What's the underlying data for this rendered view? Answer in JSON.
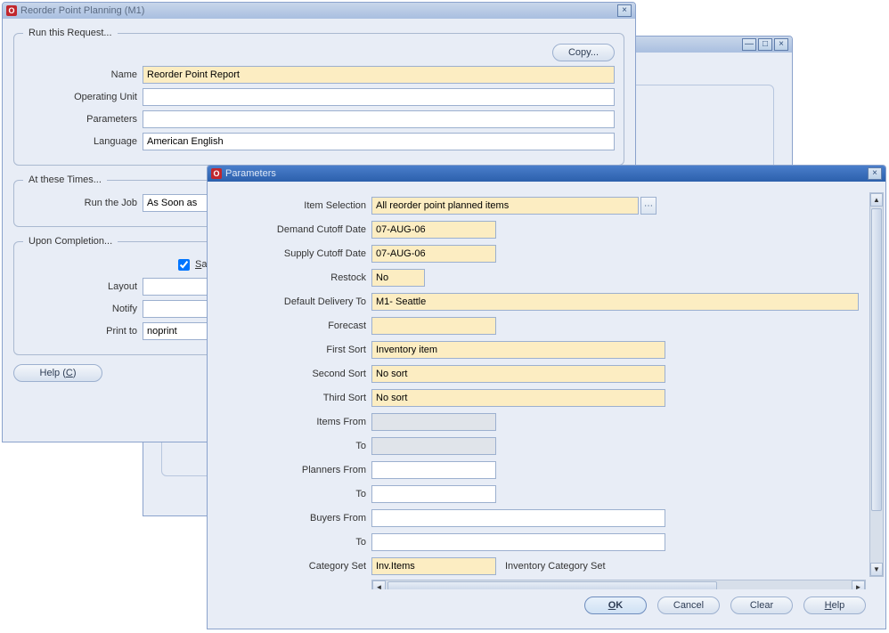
{
  "back_window": {
    "minimize_title": "Minimize",
    "maximize_title": "Maximize",
    "close_title": "Close"
  },
  "rpp": {
    "title": "Reorder Point Planning (M1)",
    "run_legend": "Run this Request...",
    "copy_label": "Copy...",
    "name_label": "Name",
    "name_value": "Reorder Point Report",
    "op_unit_label": "Operating Unit",
    "op_unit_value": "",
    "parameters_label": "Parameters",
    "parameters_value": "",
    "language_label": "Language",
    "language_value": "American English",
    "times_legend": "At these Times...",
    "run_job_label": "Run the Job",
    "run_job_value": "As Soon as",
    "completion_legend": "Upon Completion...",
    "save_all_checked": true,
    "save_all_label": "Save all Ou",
    "layout_label": "Layout",
    "layout_value": "",
    "notify_label": "Notify",
    "notify_value": "",
    "print_to_label": "Print to",
    "print_to_value": "noprint",
    "help_label": "Help (C)"
  },
  "params": {
    "title": "Parameters",
    "rows": {
      "item_selection": {
        "label": "Item Selection",
        "value": "All reorder point planned items"
      },
      "demand_cutoff": {
        "label": "Demand Cutoff Date",
        "value": "07-AUG-06"
      },
      "supply_cutoff": {
        "label": "Supply Cutoff Date",
        "value": "07-AUG-06"
      },
      "restock": {
        "label": "Restock",
        "value": "No"
      },
      "default_deliv": {
        "label": "Default Delivery To",
        "value": "M1- Seattle"
      },
      "forecast": {
        "label": "Forecast",
        "value": ""
      },
      "first_sort": {
        "label": "First Sort",
        "value": "Inventory item"
      },
      "second_sort": {
        "label": "Second Sort",
        "value": "No sort"
      },
      "third_sort": {
        "label": "Third Sort",
        "value": "No sort"
      },
      "items_from": {
        "label": "Items From",
        "value": ""
      },
      "items_to": {
        "label": "To",
        "value": ""
      },
      "planners_from": {
        "label": "Planners From",
        "value": ""
      },
      "planners_to": {
        "label": "To",
        "value": ""
      },
      "buyers_from": {
        "label": "Buyers From",
        "value": ""
      },
      "buyers_to": {
        "label": "To",
        "value": ""
      },
      "category_set": {
        "label": "Category Set",
        "value": "Inv.Items",
        "desc": "Inventory Category Set"
      }
    },
    "buttons": {
      "ok": "OK",
      "cancel": "Cancel",
      "clear": "Clear",
      "help": "Help"
    }
  }
}
